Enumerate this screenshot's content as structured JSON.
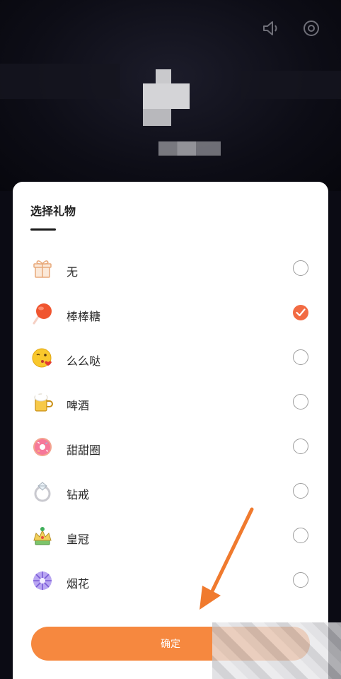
{
  "sheet": {
    "title": "选择礼物",
    "confirm_label": "确定"
  },
  "gifts": [
    {
      "label": "无",
      "icon": "gift-box-icon",
      "selected": false
    },
    {
      "label": "棒棒糖",
      "icon": "lollipop-icon",
      "selected": true
    },
    {
      "label": "么么哒",
      "icon": "kiss-emoji-icon",
      "selected": false
    },
    {
      "label": "啤酒",
      "icon": "beer-icon",
      "selected": false
    },
    {
      "label": "甜甜圈",
      "icon": "donut-icon",
      "selected": false
    },
    {
      "label": "钻戒",
      "icon": "diamond-ring-icon",
      "selected": false
    },
    {
      "label": "皇冠",
      "icon": "crown-icon",
      "selected": false
    },
    {
      "label": "烟花",
      "icon": "fireworks-icon",
      "selected": false
    }
  ],
  "colors": {
    "accent": "#f26b43",
    "button": "#f6883f",
    "annotation_arrow": "#f07a2e"
  }
}
